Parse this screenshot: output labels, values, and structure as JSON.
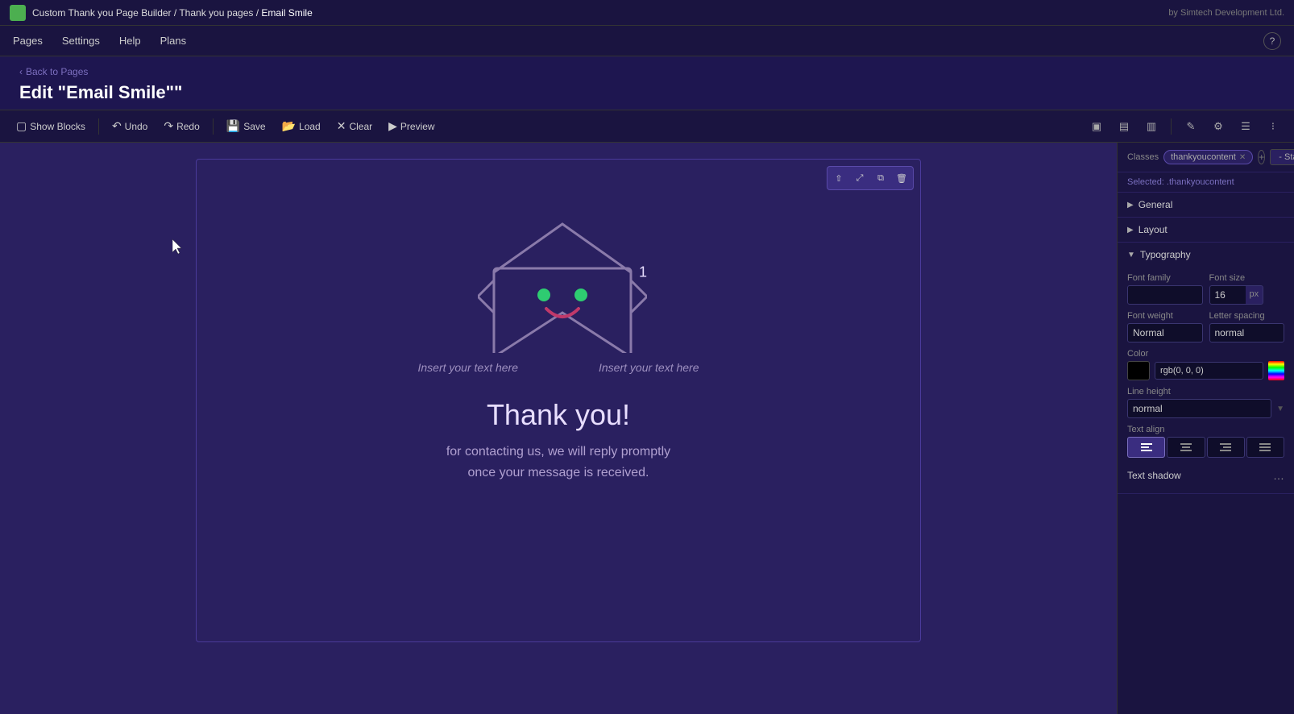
{
  "topbar": {
    "logo_alt": "logo",
    "breadcrumb_part1": "Custom Thank you Page Builder",
    "breadcrumb_sep1": " / ",
    "breadcrumb_part2": "Thank you pages",
    "breadcrumb_sep2": " / ",
    "breadcrumb_current": "Email Smile",
    "by_vendor": "by Simtech Development Ltd."
  },
  "navbar": {
    "items": [
      {
        "label": "Pages",
        "id": "pages"
      },
      {
        "label": "Settings",
        "id": "settings"
      },
      {
        "label": "Help",
        "id": "help"
      },
      {
        "label": "Plans",
        "id": "plans"
      }
    ],
    "help_icon": "?"
  },
  "edit_header": {
    "back_label": "Back to Pages",
    "page_title": "Edit \"Email Smile\"\""
  },
  "toolbar": {
    "show_blocks": "Show Blocks",
    "undo": "Undo",
    "redo": "Redo",
    "save": "Save",
    "load": "Load",
    "clear": "Clear",
    "preview": "Preview"
  },
  "canvas": {
    "float_toolbar_buttons": [
      "↑",
      "⤢",
      "⧉",
      "✕"
    ],
    "email_badge": "1"
  },
  "email_content": {
    "text_left": "Insert your text here",
    "text_right": "Insert your text here",
    "thank_you_heading": "Thank you!",
    "thank_you_body": "for contacting us, we will reply promptly\nonce your message is received."
  },
  "right_panel": {
    "classes_label": "Classes",
    "state_label": "- State -",
    "class_name": "thankyoucontent",
    "selected_label": "Selected: .thankyoucontent",
    "sections": [
      {
        "label": "General",
        "id": "general",
        "expanded": false
      },
      {
        "label": "Layout",
        "id": "layout",
        "expanded": false
      },
      {
        "label": "Typography",
        "id": "typography",
        "expanded": true
      }
    ],
    "typography": {
      "font_family_label": "Font family",
      "font_size_label": "Font size",
      "font_size_value": "16",
      "font_size_unit": "px",
      "font_weight_label": "Font weight",
      "font_weight_value": "Normal",
      "letter_spacing_label": "Letter spacing",
      "letter_spacing_value": "normal",
      "color_label": "Color",
      "color_value": "rgb(0, 0, 0)",
      "line_height_label": "Line height",
      "line_height_value": "normal",
      "text_align_label": "Text align",
      "text_align_options": [
        {
          "icon": "≡",
          "id": "left",
          "title": "Left",
          "active": true
        },
        {
          "icon": "☰",
          "id": "center",
          "title": "Center",
          "active": false
        },
        {
          "icon": "≡",
          "id": "right",
          "title": "Right",
          "active": false
        },
        {
          "icon": "≡",
          "id": "justify",
          "title": "Justify",
          "active": false
        }
      ],
      "text_shadow_label": "Text shadow"
    }
  }
}
